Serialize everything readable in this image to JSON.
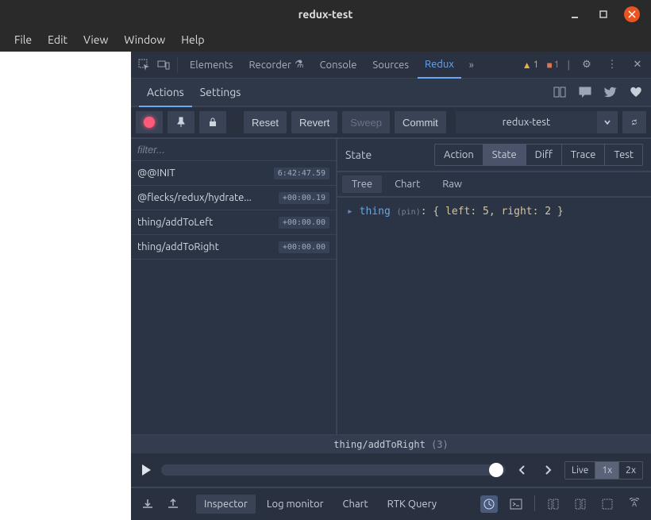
{
  "window": {
    "title": "redux-test"
  },
  "menubar": [
    "File",
    "Edit",
    "View",
    "Window",
    "Help"
  ],
  "devtools_tabs": [
    "Elements",
    "Recorder",
    "Console",
    "Sources",
    "Redux"
  ],
  "devtools_active": "Redux",
  "badges": {
    "warn": "1",
    "err": "1"
  },
  "redux": {
    "subtabs": [
      "Actions",
      "Settings"
    ],
    "active_subtab": "Actions",
    "toolbar": {
      "reset": "Reset",
      "revert": "Revert",
      "sweep": "Sweep",
      "commit": "Commit",
      "instance": "redux-test"
    },
    "filter_placeholder": "filter...",
    "actions": [
      {
        "name": "@@INIT",
        "time": "6:42:47.59"
      },
      {
        "name": "@flecks/redux/hydrate...",
        "time": "+00:00.19"
      },
      {
        "name": "thing/addToLeft",
        "time": "+00:00.00"
      },
      {
        "name": "thing/addToRight",
        "time": "+00:00.00"
      }
    ],
    "state_panel": {
      "label": "State",
      "tabs": [
        "Action",
        "State",
        "Diff",
        "Trace",
        "Test"
      ],
      "active_tab": "State",
      "formats": [
        "Tree",
        "Chart",
        "Raw"
      ],
      "active_format": "Tree",
      "tree": {
        "key": "thing",
        "pin": "(pin)",
        "body": ": { left: 5, right: 2 }"
      }
    },
    "scrubber": {
      "action": "thing/addToRight",
      "count": "(3)"
    },
    "player": {
      "speeds": [
        "Live",
        "1x",
        "2x"
      ],
      "active_speed": "1x"
    },
    "monitors": [
      "Inspector",
      "Log monitor",
      "Chart",
      "RTK Query"
    ],
    "active_monitor": "Inspector"
  }
}
